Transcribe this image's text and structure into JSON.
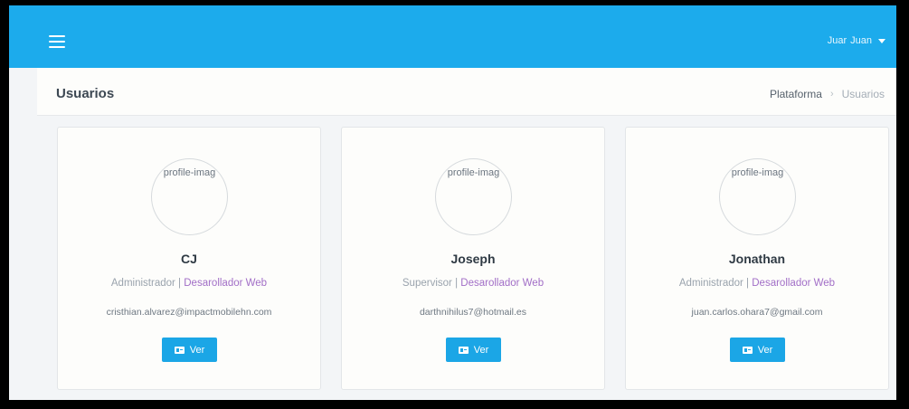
{
  "navbar": {
    "menu_icon": "hamburger-icon",
    "user_first": "Juar",
    "user_second": "Juan",
    "caret_icon": "caret-down-icon"
  },
  "header": {
    "title": "Usuarios",
    "breadcrumb": {
      "root": "Plataforma",
      "separator": "›",
      "current": "Usuarios"
    }
  },
  "colors": {
    "navbar": "#1cabec",
    "button": "#1ba6e6",
    "department": "#a26fc7"
  },
  "users": [
    {
      "avatar_alt": "profile-imag",
      "name": "CJ",
      "role": "Administrador",
      "separator": "|",
      "department": "Desarollador Web",
      "email": "cristhian.alvarez@impactmobilehn.com",
      "button_label": "Ver",
      "button_icon": "id-card-icon"
    },
    {
      "avatar_alt": "profile-imag",
      "name": "Joseph",
      "role": "Supervisor",
      "separator": "|",
      "department": "Desarollador Web",
      "email": "darthnihilus7@hotmail.es",
      "button_label": "Ver",
      "button_icon": "id-card-icon"
    },
    {
      "avatar_alt": "profile-imag",
      "name": "Jonathan",
      "role": "Administrador",
      "separator": "|",
      "department": "Desarollador Web",
      "email": "juan.carlos.ohara7@gmail.com",
      "button_label": "Ver",
      "button_icon": "id-card-icon"
    }
  ]
}
